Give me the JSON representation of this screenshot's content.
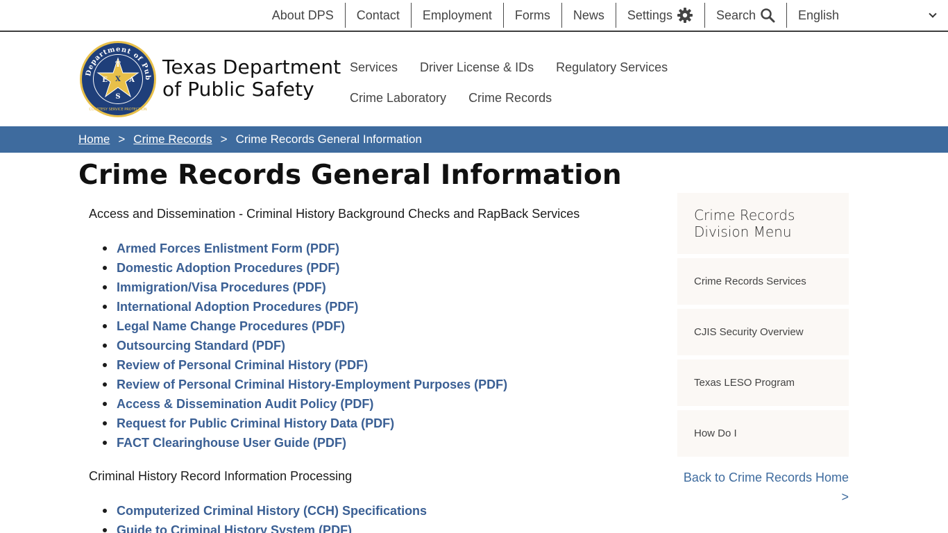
{
  "utility_nav": {
    "items": [
      "About DPS",
      "Contact",
      "Employment",
      "Forms",
      "News"
    ],
    "settings_label": "Settings",
    "search_label": "Search",
    "language": "English"
  },
  "header": {
    "title_line1": "Texas Department",
    "title_line2": "of Public Safety",
    "seal": {
      "ring_text": "Department of Public Safety",
      "letters": [
        "T",
        "E",
        "X",
        "A",
        "S"
      ],
      "motto": "COURTESY SERVICE PROTECTION"
    }
  },
  "main_nav": {
    "items": [
      "Services",
      "Driver License & IDs",
      "Regulatory Services",
      "Crime Laboratory",
      "Crime Records"
    ]
  },
  "breadcrumb": {
    "home": "Home",
    "parent": "Crime Records",
    "current": "Crime Records General Information",
    "separator": ">"
  },
  "page_title": "Crime Records General Information",
  "sections": [
    {
      "heading": "Access and Dissemination - Criminal History Background Checks and RapBack Services",
      "links": [
        "Armed Forces Enlistment Form (PDF)",
        "Domestic Adoption Procedures (PDF)",
        "Immigration/Visa Procedures (PDF)",
        "International Adoption Procedures (PDF)",
        "Legal Name Change Procedures (PDF)",
        "Outsourcing Standard (PDF)",
        "Review of Personal Criminal History (PDF)",
        "Review of Personal Criminal History-Employment Purposes (PDF)",
        "Access & Dissemination Audit Policy (PDF)",
        "Request for Public Criminal History Data (PDF)",
        "FACT Clearinghouse User Guide (PDF)"
      ]
    },
    {
      "heading": "Criminal History Record Information Processing",
      "links": [
        "Computerized Criminal History (CCH) Specifications",
        "Guide to Criminal History System (PDF)"
      ]
    }
  ],
  "sidebar": {
    "title": "Crime Records Division Menu",
    "items": [
      "Crime Records Services",
      "CJIS Security Overview",
      "Texas LESO Program",
      "How Do I"
    ],
    "back_link": "Back to Crime Records Home >"
  },
  "colors": {
    "breadcrumb_bg": "#3e6b9e",
    "link": "#3a5f94",
    "sidebar_bg": "#fbf8f5",
    "seal_blue": "#1f3f7a",
    "seal_gold": "#e8c04a"
  },
  "icons": {
    "settings": "gear-icon",
    "search": "search-icon",
    "language": "chevron-down-icon"
  }
}
